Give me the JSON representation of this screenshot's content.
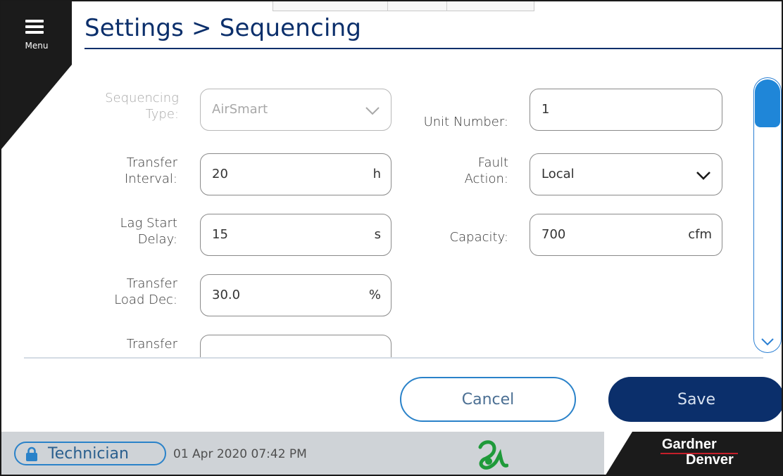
{
  "header": {
    "title": "Settings > Sequencing",
    "menu_label": "Menu"
  },
  "form": {
    "sequencing_type": {
      "label_line1": "Sequencing",
      "label_line2": "Type:",
      "value": "AirSmart",
      "disabled": true
    },
    "transfer_interval": {
      "label_line1": "Transfer",
      "label_line2": "Interval:",
      "value": "20",
      "unit": "h"
    },
    "lag_start_delay": {
      "label_line1": "Lag Start",
      "label_line2": "Delay:",
      "value": "15",
      "unit": "s"
    },
    "transfer_load_dec": {
      "label_line1": "Transfer",
      "label_line2": "Load Dec:",
      "value": "30.0",
      "unit": "%"
    },
    "transfer_partial": {
      "label_line1": "Transfer"
    },
    "unit_number": {
      "label": "Unit Number:",
      "value": "1"
    },
    "fault_action": {
      "label_line1": "Fault",
      "label_line2": "Action:",
      "value": "Local"
    },
    "capacity": {
      "label": "Capacity:",
      "value": "700",
      "unit": "cfm"
    }
  },
  "buttons": {
    "cancel": "Cancel",
    "save": "Save"
  },
  "status_bar": {
    "user_role": "Technician",
    "datetime": "01 Apr 2020  07:42 PM",
    "brand_line1": "Gardner",
    "brand_line2": "Denver"
  },
  "colors": {
    "title_blue": "#0b2f6b",
    "accent_blue": "#2a82c9",
    "scroll_blue": "#1f86d8",
    "status_gray": "#cfd3d7",
    "logo_green": "#1f9a3a",
    "brand_red": "#c51f2a"
  },
  "icons": [
    "menu-icon",
    "chevron-down-icon",
    "lock-icon",
    "scroll-down-chevron-icon",
    "company-logo-icon"
  ]
}
